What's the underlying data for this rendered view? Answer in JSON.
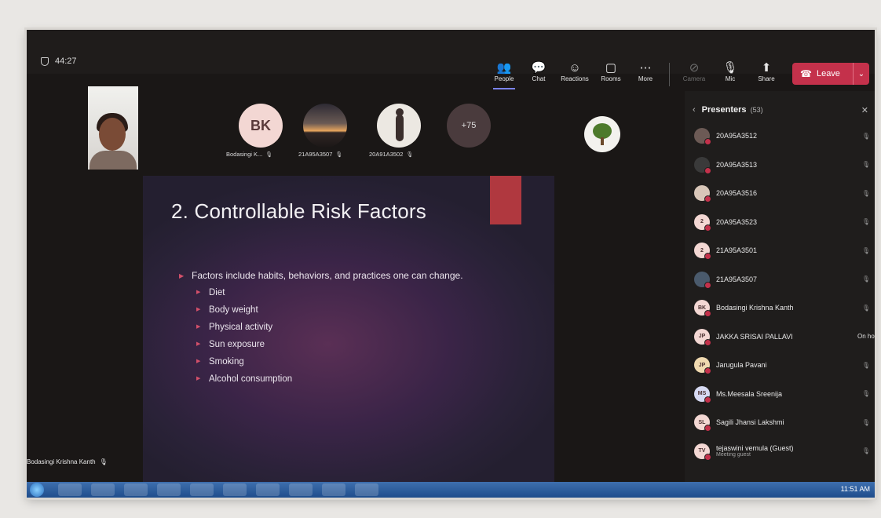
{
  "meeting": {
    "timer": "44:27"
  },
  "toolbar": {
    "people": "People",
    "chat": "Chat",
    "reactions": "Reactions",
    "rooms": "Rooms",
    "more": "More",
    "camera": "Camera",
    "mic": "Mic",
    "share": "Share",
    "leave": "Leave"
  },
  "participants": {
    "bk_initials": "BK",
    "bk_name": "Bodasingi K...",
    "p2_name": "21A95A3507",
    "p3_name": "20A91A3502",
    "overflow": "+75"
  },
  "slide": {
    "title": "2. Controllable Risk Factors",
    "main_bullet": "Factors include habits, behaviors, and practices one can change.",
    "sub_bullets": [
      "Diet",
      "Body weight",
      "Physical activity",
      "Sun exposure",
      "Smoking",
      "Alcohol consumption"
    ]
  },
  "presenter_name": "Bodasingi Krishna Kanth",
  "panel": {
    "title": "Presenters",
    "count": "(53)",
    "rows": [
      {
        "name": "20A95A3512",
        "initials": "",
        "sub": "",
        "status": ""
      },
      {
        "name": "20A95A3513",
        "initials": "",
        "sub": "",
        "status": ""
      },
      {
        "name": "20A95A3516",
        "initials": "",
        "sub": "",
        "status": ""
      },
      {
        "name": "20A95A3523",
        "initials": "2",
        "sub": "",
        "status": ""
      },
      {
        "name": "21A95A3501",
        "initials": "2",
        "sub": "",
        "status": ""
      },
      {
        "name": "21A95A3507",
        "initials": "",
        "sub": "",
        "status": ""
      },
      {
        "name": "Bodasingi Krishna Kanth",
        "initials": "BK",
        "sub": "",
        "status": ""
      },
      {
        "name": "JAKKA SRISAI PALLAVI",
        "initials": "JP",
        "sub": "",
        "status": "On hold"
      },
      {
        "name": "Jarugula Pavani",
        "initials": "JP",
        "sub": "",
        "status": ""
      },
      {
        "name": "Ms.Meesala Sreenija",
        "initials": "MS",
        "sub": "",
        "status": ""
      },
      {
        "name": "Sagili Jhansi Lakshmi",
        "initials": "SL",
        "sub": "",
        "status": ""
      },
      {
        "name": "tejaswini vemula (Guest)",
        "initials": "TV",
        "sub": "Meeting guest",
        "status": ""
      }
    ]
  },
  "taskbar": {
    "clock": "11:51 AM"
  },
  "colors": {
    "leave": "#c4314b",
    "accent": "#7b83eb",
    "slide_accent": "#b0383f",
    "bullet": "#d3506a"
  }
}
